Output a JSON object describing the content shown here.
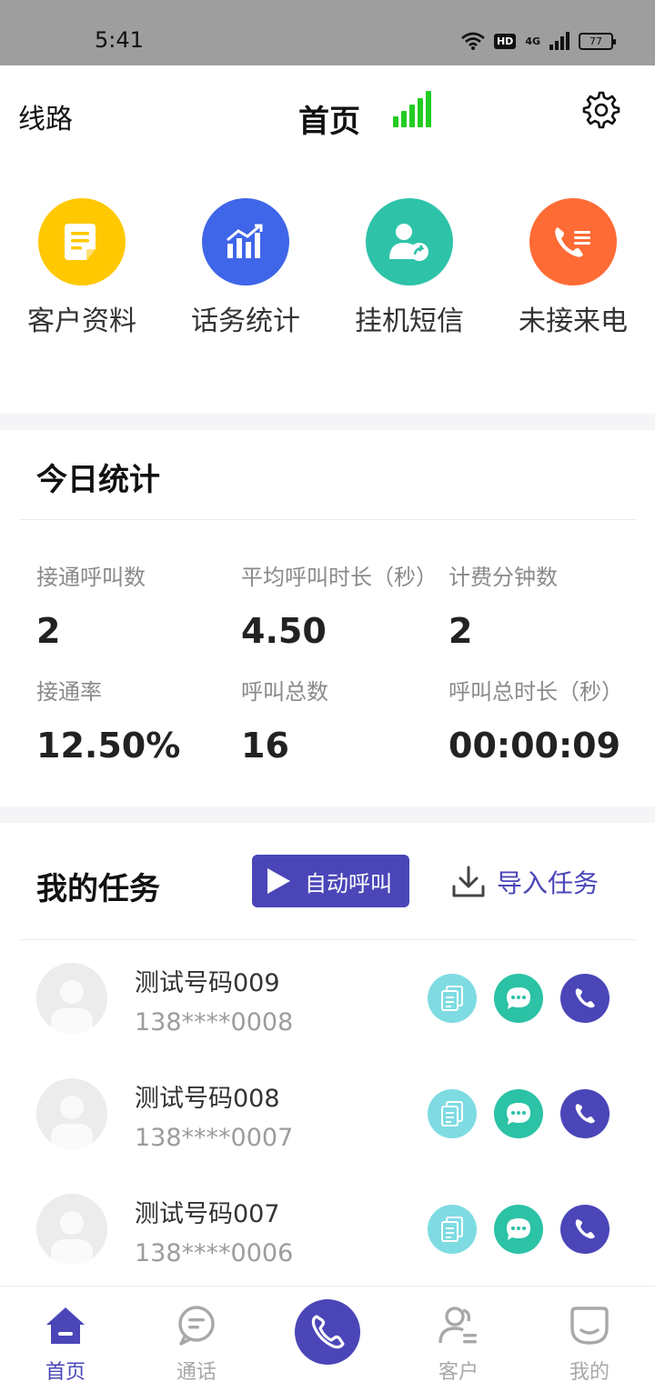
{
  "status_bar": {
    "time": "5:41",
    "hd": "HD",
    "network": "4G",
    "battery": "77"
  },
  "header": {
    "route_label": "线路",
    "title": "首页"
  },
  "quick_actions": [
    {
      "label": "客户资料",
      "icon": "document-icon",
      "color": "#ffc800"
    },
    {
      "label": "话务统计",
      "icon": "bar-chart-icon",
      "color": "#3f66e8"
    },
    {
      "label": "挂机短信",
      "icon": "user-share-icon",
      "color": "#2ec3a9"
    },
    {
      "label": "未接来电",
      "icon": "missed-call-icon",
      "color": "#ff6b35"
    }
  ],
  "today_stats": {
    "title": "今日统计",
    "items": [
      {
        "label": "接通呼叫数",
        "value": "2"
      },
      {
        "label": "平均呼叫时长（秒）",
        "value": "4.50"
      },
      {
        "label": "计费分钟数",
        "value": "2"
      },
      {
        "label": "接通率",
        "value": "12.50%"
      },
      {
        "label": "呼叫总数",
        "value": "16"
      },
      {
        "label": "呼叫总时长（秒）",
        "value": "00:00:09"
      }
    ]
  },
  "tasks": {
    "title": "我的任务",
    "auto_call_label": "自动呼叫",
    "import_label": "导入任务",
    "rows": [
      {
        "name": "测试号码009",
        "phone": "138****0008"
      },
      {
        "name": "测试号码008",
        "phone": "138****0007"
      },
      {
        "name": "测试号码007",
        "phone": "138****0006"
      }
    ]
  },
  "bottom_nav": [
    {
      "label": "首页",
      "icon": "home-icon",
      "active": true
    },
    {
      "label": "通话",
      "icon": "chat-icon",
      "active": false
    },
    {
      "label": "",
      "icon": "phone-icon",
      "active": false
    },
    {
      "label": "客户",
      "icon": "customer-icon",
      "active": false
    },
    {
      "label": "我的",
      "icon": "profile-icon",
      "active": false
    }
  ],
  "colors": {
    "accent": "#4a46b8",
    "signal": "#22cc22"
  }
}
